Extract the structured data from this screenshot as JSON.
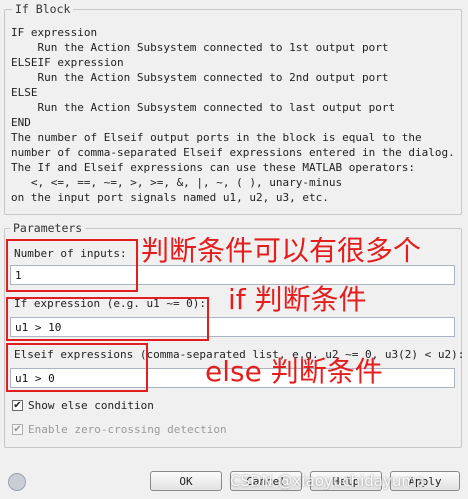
{
  "block": {
    "title": "If Block",
    "description": [
      "IF expression",
      "    Run the Action Subsystem connected to 1st output port",
      "ELSEIF expression",
      "    Run the Action Subsystem connected to 2nd output port",
      "ELSE",
      "    Run the Action Subsystem connected to last output port",
      "END",
      "The number of Elseif output ports in the block is equal to the",
      "number of comma-separated Elseif expressions entered in the dialog.",
      "The If and Elseif expressions can use these MATLAB operators:",
      "   <, <=, ==, ~=, >, >=, &, |, ~, ( ), unary-minus",
      "on the input port signals named u1, u2, u3, etc."
    ]
  },
  "parameters": {
    "title": "Parameters",
    "num_inputs_label": "Number of inputs:",
    "num_inputs_value": "1",
    "if_expr_label": "If expression (e.g. u1 ~= 0):",
    "if_expr_value": "u1 > 10",
    "elseif_label": "Elseif expressions (comma-separated list, e.g. u2 ~= 0, u3(2) < u2):",
    "elseif_value": "u1 > 0",
    "show_else_label": "Show else condition",
    "show_else_checked": true,
    "zero_crossing_label": "Enable zero-crossing detection",
    "zero_crossing_checked": true
  },
  "buttons": {
    "ok": "OK",
    "cancel": "Cancel",
    "help": "Help",
    "apply": "Apply"
  },
  "annotations": {
    "num_inputs": "判断条件可以有很多个",
    "if_expr": "if 判断条件",
    "elseif": "else  判断条件"
  },
  "watermark": "CSDN @xiaoyuchidayuma",
  "colors": {
    "annotation_red": "#e41e1e",
    "background": "#f0f0f0"
  }
}
